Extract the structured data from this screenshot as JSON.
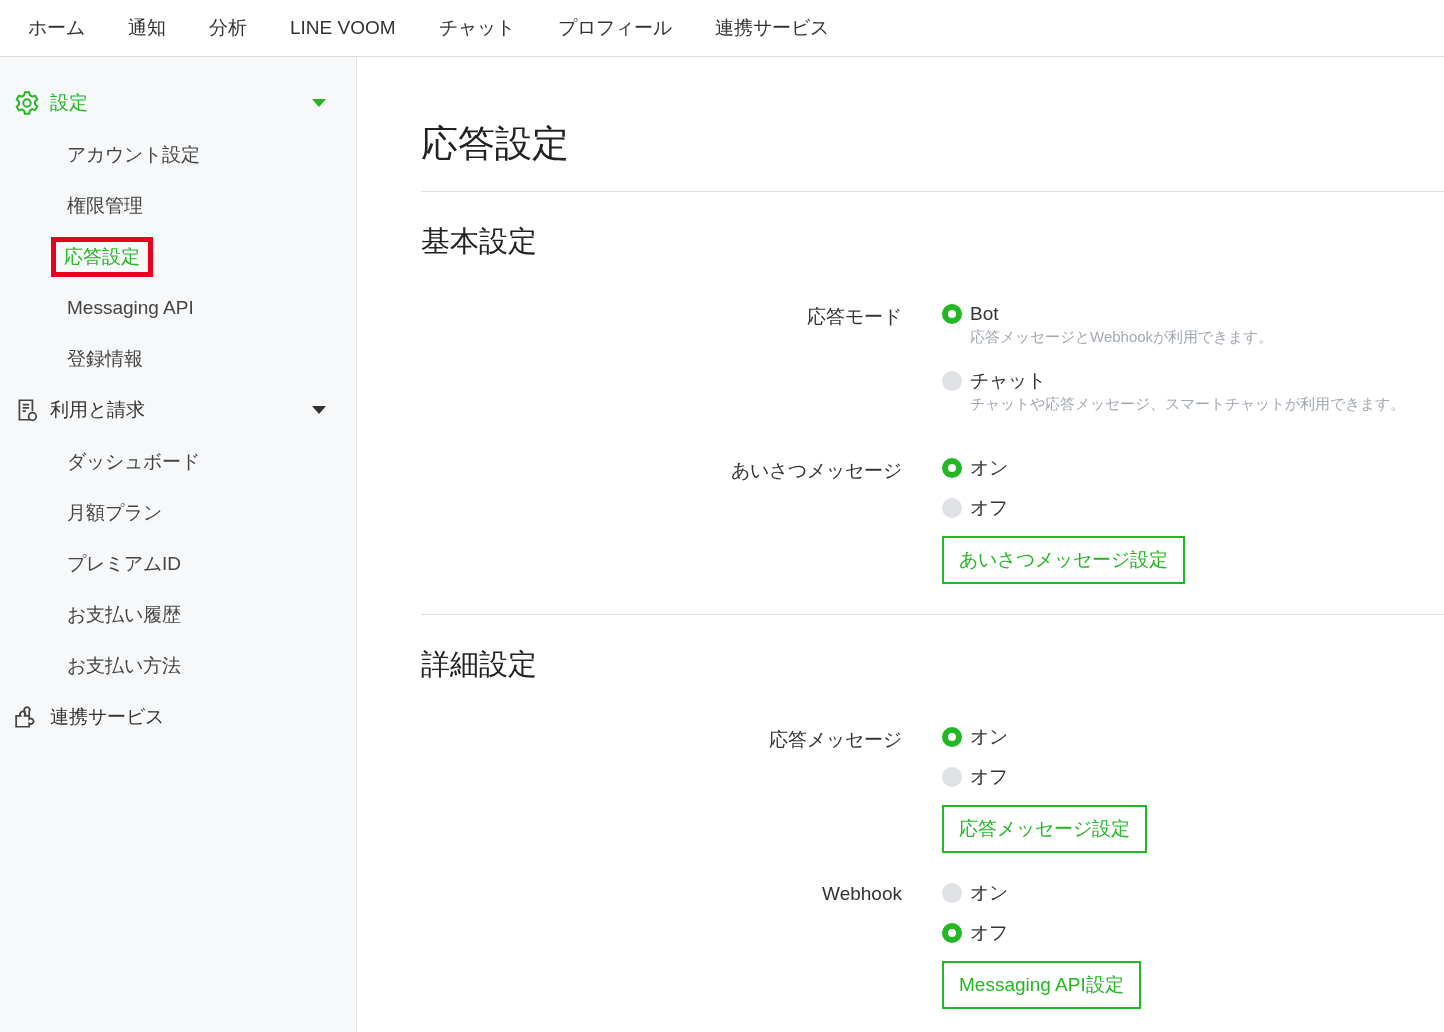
{
  "nav": [
    {
      "label": "ホーム"
    },
    {
      "label": "通知"
    },
    {
      "label": "分析"
    },
    {
      "label": "LINE VOOM"
    },
    {
      "label": "チャット"
    },
    {
      "label": "プロフィール"
    },
    {
      "label": "連携サービス"
    }
  ],
  "sidebar": {
    "groups": [
      {
        "kind": "gear",
        "label": "設定",
        "selected": true,
        "caret": true,
        "children": [
          {
            "label": "アカウント設定",
            "selected": false,
            "annotated": false
          },
          {
            "label": "権限管理",
            "selected": false,
            "annotated": false
          },
          {
            "label": "応答設定",
            "selected": true,
            "annotated": true
          },
          {
            "label": "Messaging API",
            "selected": false,
            "annotated": false
          },
          {
            "label": "登録情報",
            "selected": false,
            "annotated": false
          }
        ]
      },
      {
        "kind": "document",
        "label": "利用と請求",
        "selected": false,
        "caret": true,
        "children": [
          {
            "label": "ダッシュボード",
            "selected": false,
            "annotated": false
          },
          {
            "label": "月額プラン",
            "selected": false,
            "annotated": false
          },
          {
            "label": "プレミアムID",
            "selected": false,
            "annotated": false
          },
          {
            "label": "お支払い履歴",
            "selected": false,
            "annotated": false
          },
          {
            "label": "お支払い方法",
            "selected": false,
            "annotated": false
          }
        ]
      },
      {
        "kind": "puzzle",
        "label": "連携サービス",
        "selected": false,
        "caret": false
      }
    ]
  },
  "content": {
    "title": "応答設定",
    "sections": [
      {
        "title": "基本設定",
        "settings": [
          {
            "label": "応答モード",
            "options": [
              {
                "label": "Bot",
                "selected": true,
                "description": "応答メッセージとWebhookが利用できます。"
              },
              {
                "label": "チャット",
                "selected": false,
                "description": "チャットや応答メッセージ、スマートチャットが利用できます。"
              }
            ]
          },
          {
            "label": "あいさつメッセージ",
            "options": [
              {
                "label": "オン",
                "selected": true
              },
              {
                "label": "オフ",
                "selected": false
              }
            ],
            "button": "あいさつメッセージ設定"
          }
        ]
      },
      {
        "title": "詳細設定",
        "settings": [
          {
            "label": "応答メッセージ",
            "options": [
              {
                "label": "オン",
                "selected": true
              },
              {
                "label": "オフ",
                "selected": false
              }
            ],
            "button": "応答メッセージ設定"
          },
          {
            "label": "Webhook",
            "options": [
              {
                "label": "オン",
                "selected": false
              },
              {
                "label": "オフ",
                "selected": true
              }
            ],
            "button": "Messaging API設定"
          }
        ]
      }
    ]
  }
}
